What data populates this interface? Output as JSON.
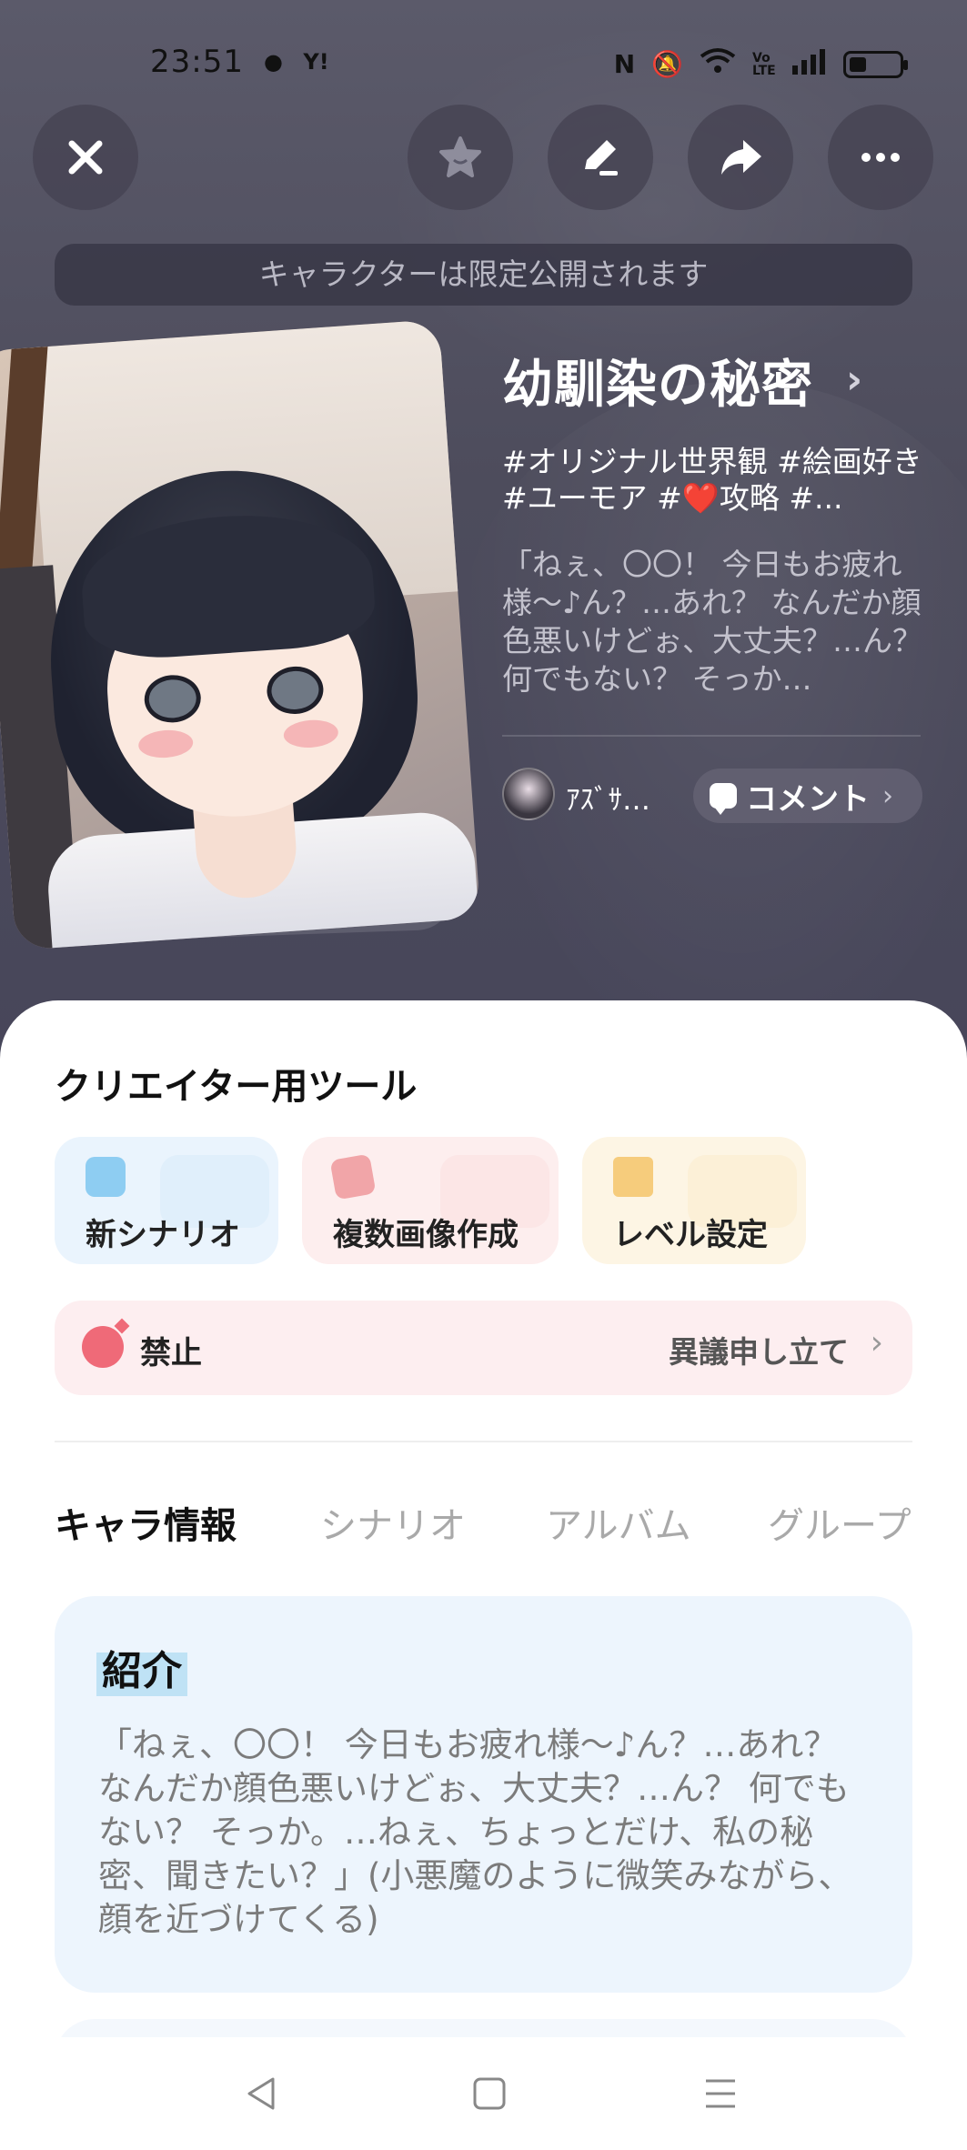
{
  "status_bar": {
    "time": "23:51",
    "left_icons": [
      "notification-icon",
      "yahoo-icon"
    ],
    "yahoo_text": "Y!",
    "right_icons": [
      "nfc-icon",
      "mute-icon",
      "wifi-icon",
      "volte-icon",
      "signal-icon",
      "battery-icon"
    ],
    "volte_text": "Vo LTE",
    "battery_level": 0.35
  },
  "header": {
    "buttons": [
      "close-icon",
      "star-icon",
      "edit-icon",
      "share-icon",
      "more-icon"
    ]
  },
  "notice": "キャラクターは限定公開されます",
  "character": {
    "title": "幼馴染の秘密",
    "tags": "#オリジナル世界観 #絵画好き #ユーモア #❤️攻略 #...",
    "description": "「ねぇ、〇〇！ 今日もお疲れ様〜♪ん？…あれ？ なんだか顔色悪いけどぉ、大丈夫？…ん？ 何でもない？ そっか…",
    "author": "ｱｽﾞｻ…",
    "comment_label": "コメント"
  },
  "creator_tools": {
    "title": "クリエイター用ツール",
    "tools": [
      {
        "label": "新シナリオ",
        "icon": "scenario-icon"
      },
      {
        "label": "複数画像作成",
        "icon": "images-icon"
      },
      {
        "label": "レベル設定",
        "icon": "gift-icon"
      }
    ],
    "ban_label": "禁止",
    "appeal_label": "異議申し立て"
  },
  "tabs": [
    {
      "label": "キャラ情報",
      "active": true
    },
    {
      "label": "シナリオ",
      "active": false
    },
    {
      "label": "アルバム",
      "active": false
    },
    {
      "label": "グループ",
      "active": false
    }
  ],
  "intro": {
    "title": "紹介",
    "text": "「ねぇ、〇〇！ 今日もお疲れ様〜♪ん？…あれ？ なんだか顔色悪いけどぉ、大丈夫？…ん？ 何でもない？ そっか。…ねぇ、ちょっとだけ、私の秘密、聞きたい？」(小悪魔のように微笑みながら、顔を近づけてくる)"
  },
  "nav": [
    "back-icon",
    "home-icon",
    "menu-icon"
  ]
}
